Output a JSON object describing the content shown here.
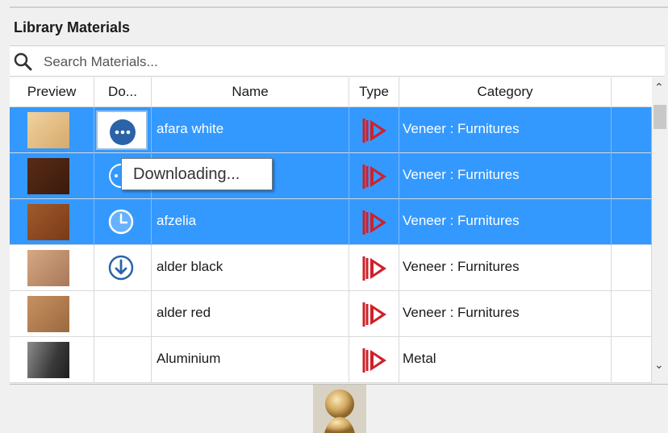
{
  "panel": {
    "title": "Library Materials"
  },
  "search": {
    "placeholder": "Search Materials..."
  },
  "columns": {
    "preview": "Preview",
    "download": "Do...",
    "name": "Name",
    "type": "Type",
    "category": "Category"
  },
  "tooltip": {
    "text": "Downloading..."
  },
  "rows": [
    {
      "name": "afara white",
      "category": "Veneer :  Furnitures",
      "selected": true,
      "download_state": "more",
      "swatch_color": "#e3c08c"
    },
    {
      "name": "",
      "category": "Veneer :  Furnitures",
      "selected": true,
      "download_state": "downloading",
      "swatch_color": "#4a2412"
    },
    {
      "name": "afzelia",
      "category": "Veneer :  Furnitures",
      "selected": true,
      "download_state": "pending",
      "swatch_color": "#8b4a22"
    },
    {
      "name": "alder black",
      "category": "Veneer :  Furnitures",
      "selected": false,
      "download_state": "download",
      "swatch_color": "#c09070"
    },
    {
      "name": "alder red",
      "category": "Veneer :  Furnitures",
      "selected": false,
      "download_state": "none",
      "swatch_color": "#b27d50"
    },
    {
      "name": "Aluminium",
      "category": "Metal",
      "selected": false,
      "download_state": "none",
      "swatch_color": "#5a5a5a"
    }
  ],
  "colors": {
    "selection": "#3399ff",
    "type_icon": "#d0202a",
    "download_icon": "#2a63a8"
  },
  "icons": {
    "search": "search-icon",
    "type": "material-type-icon",
    "more": "more-options-icon",
    "pending": "clock-icon",
    "download": "download-arrow-icon"
  }
}
